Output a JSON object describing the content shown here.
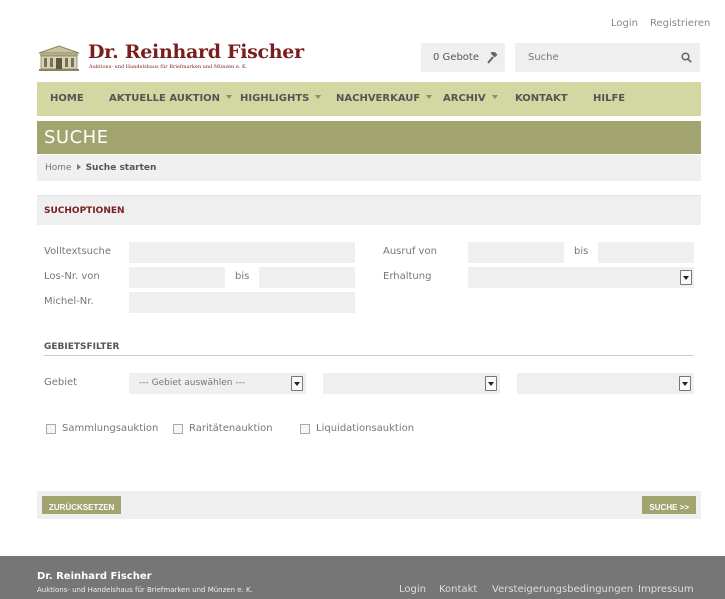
{
  "header": {
    "login_label": "Login",
    "register_label": "Registrieren",
    "logo_title": "Dr. Reinhard Fischer",
    "logo_subtitle": "Auktions- und Handelshaus für Briefmarken und Münzen e. K.",
    "bids_label": "0 Gebote",
    "search_placeholder": "Suche"
  },
  "nav": {
    "items": [
      {
        "label": "HOME",
        "dropdown": false
      },
      {
        "label": "AKTUELLE AUKTION",
        "dropdown": true
      },
      {
        "label": "HIGHLIGHTS",
        "dropdown": true
      },
      {
        "label": "NACHVERKAUF",
        "dropdown": true
      },
      {
        "label": "ARCHIV",
        "dropdown": true
      },
      {
        "label": "KONTAKT",
        "dropdown": false
      },
      {
        "label": "HILFE",
        "dropdown": false
      }
    ]
  },
  "page": {
    "title": "SUCHE",
    "breadcrumb": {
      "home": "Home",
      "current": "Suche starten"
    }
  },
  "search_options": {
    "title": "SUCHOPTIONEN",
    "fulltext_label": "Volltextsuche",
    "fulltext_value": "",
    "lot_from_label": "Los-Nr. von",
    "lot_from_value": "",
    "lot_to_label": "bis",
    "lot_to_value": "",
    "michel_label": "Michel-Nr.",
    "michel_value": "",
    "price_from_label": "Ausruf von",
    "price_from_value": "",
    "price_to_label": "bis",
    "price_to_value": "",
    "condition_label": "Erhaltung",
    "condition_value": ""
  },
  "area_filter": {
    "title": "GEBIETSFILTER",
    "area_label": "Gebiet",
    "select1_value": "--- Gebiet auswählen ---",
    "select2_value": "",
    "select3_value": ""
  },
  "checkboxes": [
    {
      "label": "Sammlungsauktion",
      "checked": false
    },
    {
      "label": "Raritätenauktion",
      "checked": false
    },
    {
      "label": "Liquidationsauktion",
      "checked": false
    }
  ],
  "actions": {
    "reset_label": "ZURÜCKSETZEN",
    "search_label": "SUCHE >>"
  },
  "footer": {
    "company_name": "Dr. Reinhard Fischer",
    "company_sub": "Auktions- und Handelshaus für Briefmarken und Münzen e. K.",
    "links": [
      "Login",
      "Kontakt",
      "Versteigerungsbedingungen",
      "Impressum"
    ]
  },
  "colors": {
    "brand_red": "#7a1d1d",
    "nav_bg": "#d3d7a1",
    "accent_olive": "#a1a46f",
    "footer_bg": "#767676"
  },
  "icons": {
    "bids": "gavel-icon",
    "search": "search-icon",
    "logo": "building-logo-icon"
  }
}
